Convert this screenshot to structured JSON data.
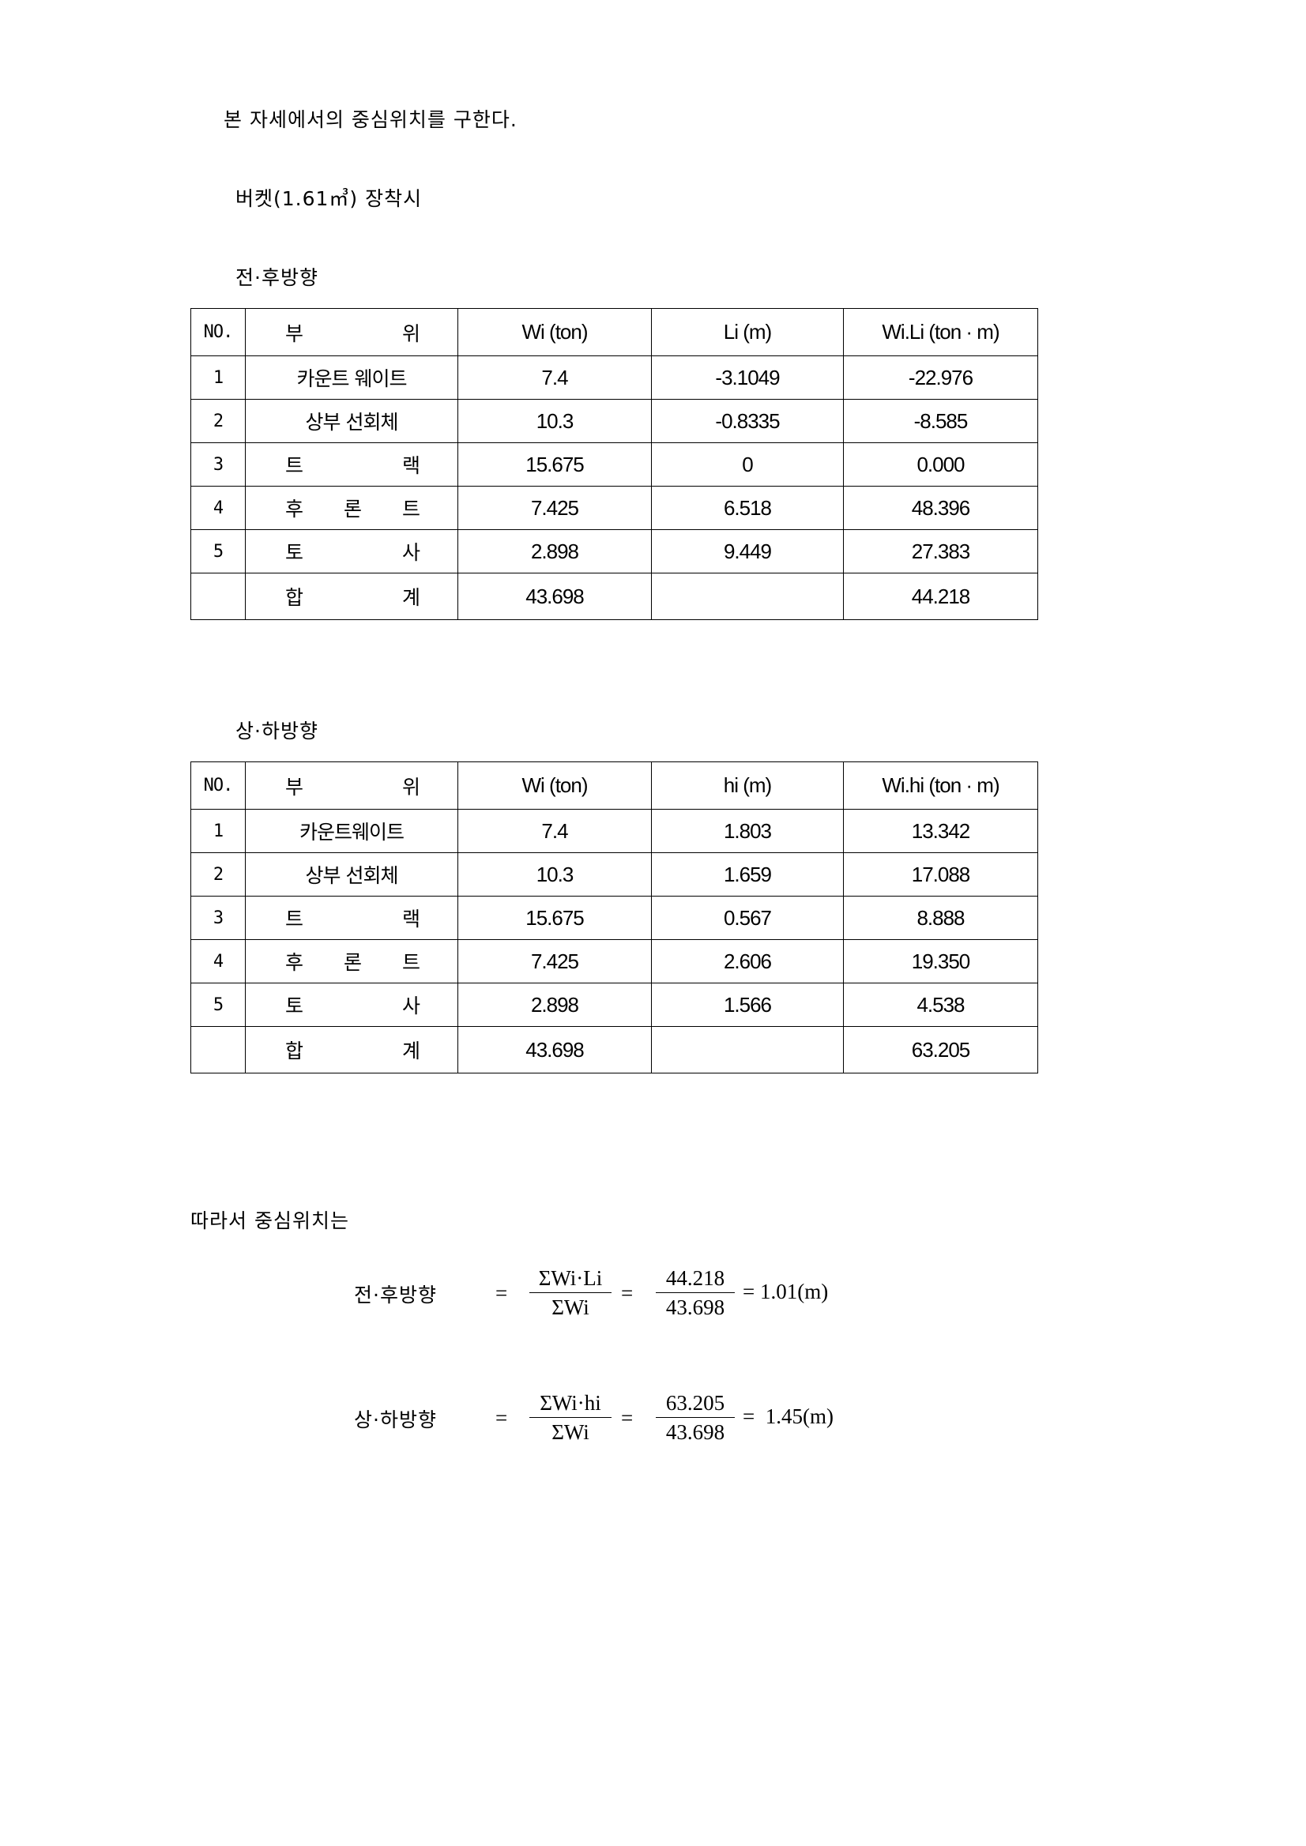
{
  "intro": "본 자세에서의 중심위치를 구한다.",
  "condition": "버켓(1.61㎥) 장착시",
  "front_back": {
    "title": "전·후방향",
    "headers": [
      "NO.",
      "부 위",
      "Wi (ton)",
      "Li (m)",
      "Wi.Li (ton · m)"
    ],
    "rows": [
      {
        "no": "1",
        "part": "카운트 웨이트",
        "wi": "7.4",
        "li": "-3.1049",
        "wl": "-22.976"
      },
      {
        "no": "2",
        "part": "상부 선회체",
        "wi": "10.3",
        "li": "-0.8335",
        "wl": "-8.585"
      },
      {
        "no": "3",
        "part": "트 랙",
        "wi": "15.675",
        "li": "0",
        "wl": "0.000"
      },
      {
        "no": "4",
        "part": "후 론 트",
        "wi": "7.425",
        "li": "6.518",
        "wl": "48.396"
      },
      {
        "no": "5",
        "part": "토 사",
        "wi": "2.898",
        "li": "9.449",
        "wl": "27.383"
      }
    ],
    "total": {
      "label": "합 계",
      "wi": "43.698",
      "li": "",
      "wl": "44.218"
    }
  },
  "up_down": {
    "title": "상·하방향",
    "headers": [
      "NO.",
      "부 위",
      "Wi (ton)",
      "hi (m)",
      "Wi.hi (ton · m)"
    ],
    "rows": [
      {
        "no": "1",
        "part": "카운트웨이트",
        "wi": "7.4",
        "hi": "1.803",
        "wh": "13.342"
      },
      {
        "no": "2",
        "part": "상부 선회체",
        "wi": "10.3",
        "hi": "1.659",
        "wh": "17.088"
      },
      {
        "no": "3",
        "part": "트 랙",
        "wi": "15.675",
        "hi": "0.567",
        "wh": "8.888"
      },
      {
        "no": "4",
        "part": "후 론 트",
        "wi": "7.425",
        "hi": "2.606",
        "wh": "19.350"
      },
      {
        "no": "5",
        "part": "토 사",
        "wi": "2.898",
        "hi": "1.566",
        "wh": "4.538"
      }
    ],
    "total": {
      "label": "합 계",
      "wi": "43.698",
      "hi": "",
      "wh": "63.205"
    }
  },
  "conclusion": "따라서 중심위치는",
  "formulas": {
    "front_back": {
      "label": "전·후방향",
      "eq": "=",
      "num1": "ΣWi·Li",
      "den1": "ΣWi",
      "eq2": "=",
      "num2": "44.218",
      "den2": "43.698",
      "result": "= 1.01(m)"
    },
    "up_down": {
      "label": "상·하방향",
      "eq": "=",
      "num1": "ΣWi·hi",
      "den1": "ΣWi",
      "eq2": "=",
      "num2": "63.205",
      "den2": "43.698",
      "result": "=  1.45(m)"
    }
  }
}
